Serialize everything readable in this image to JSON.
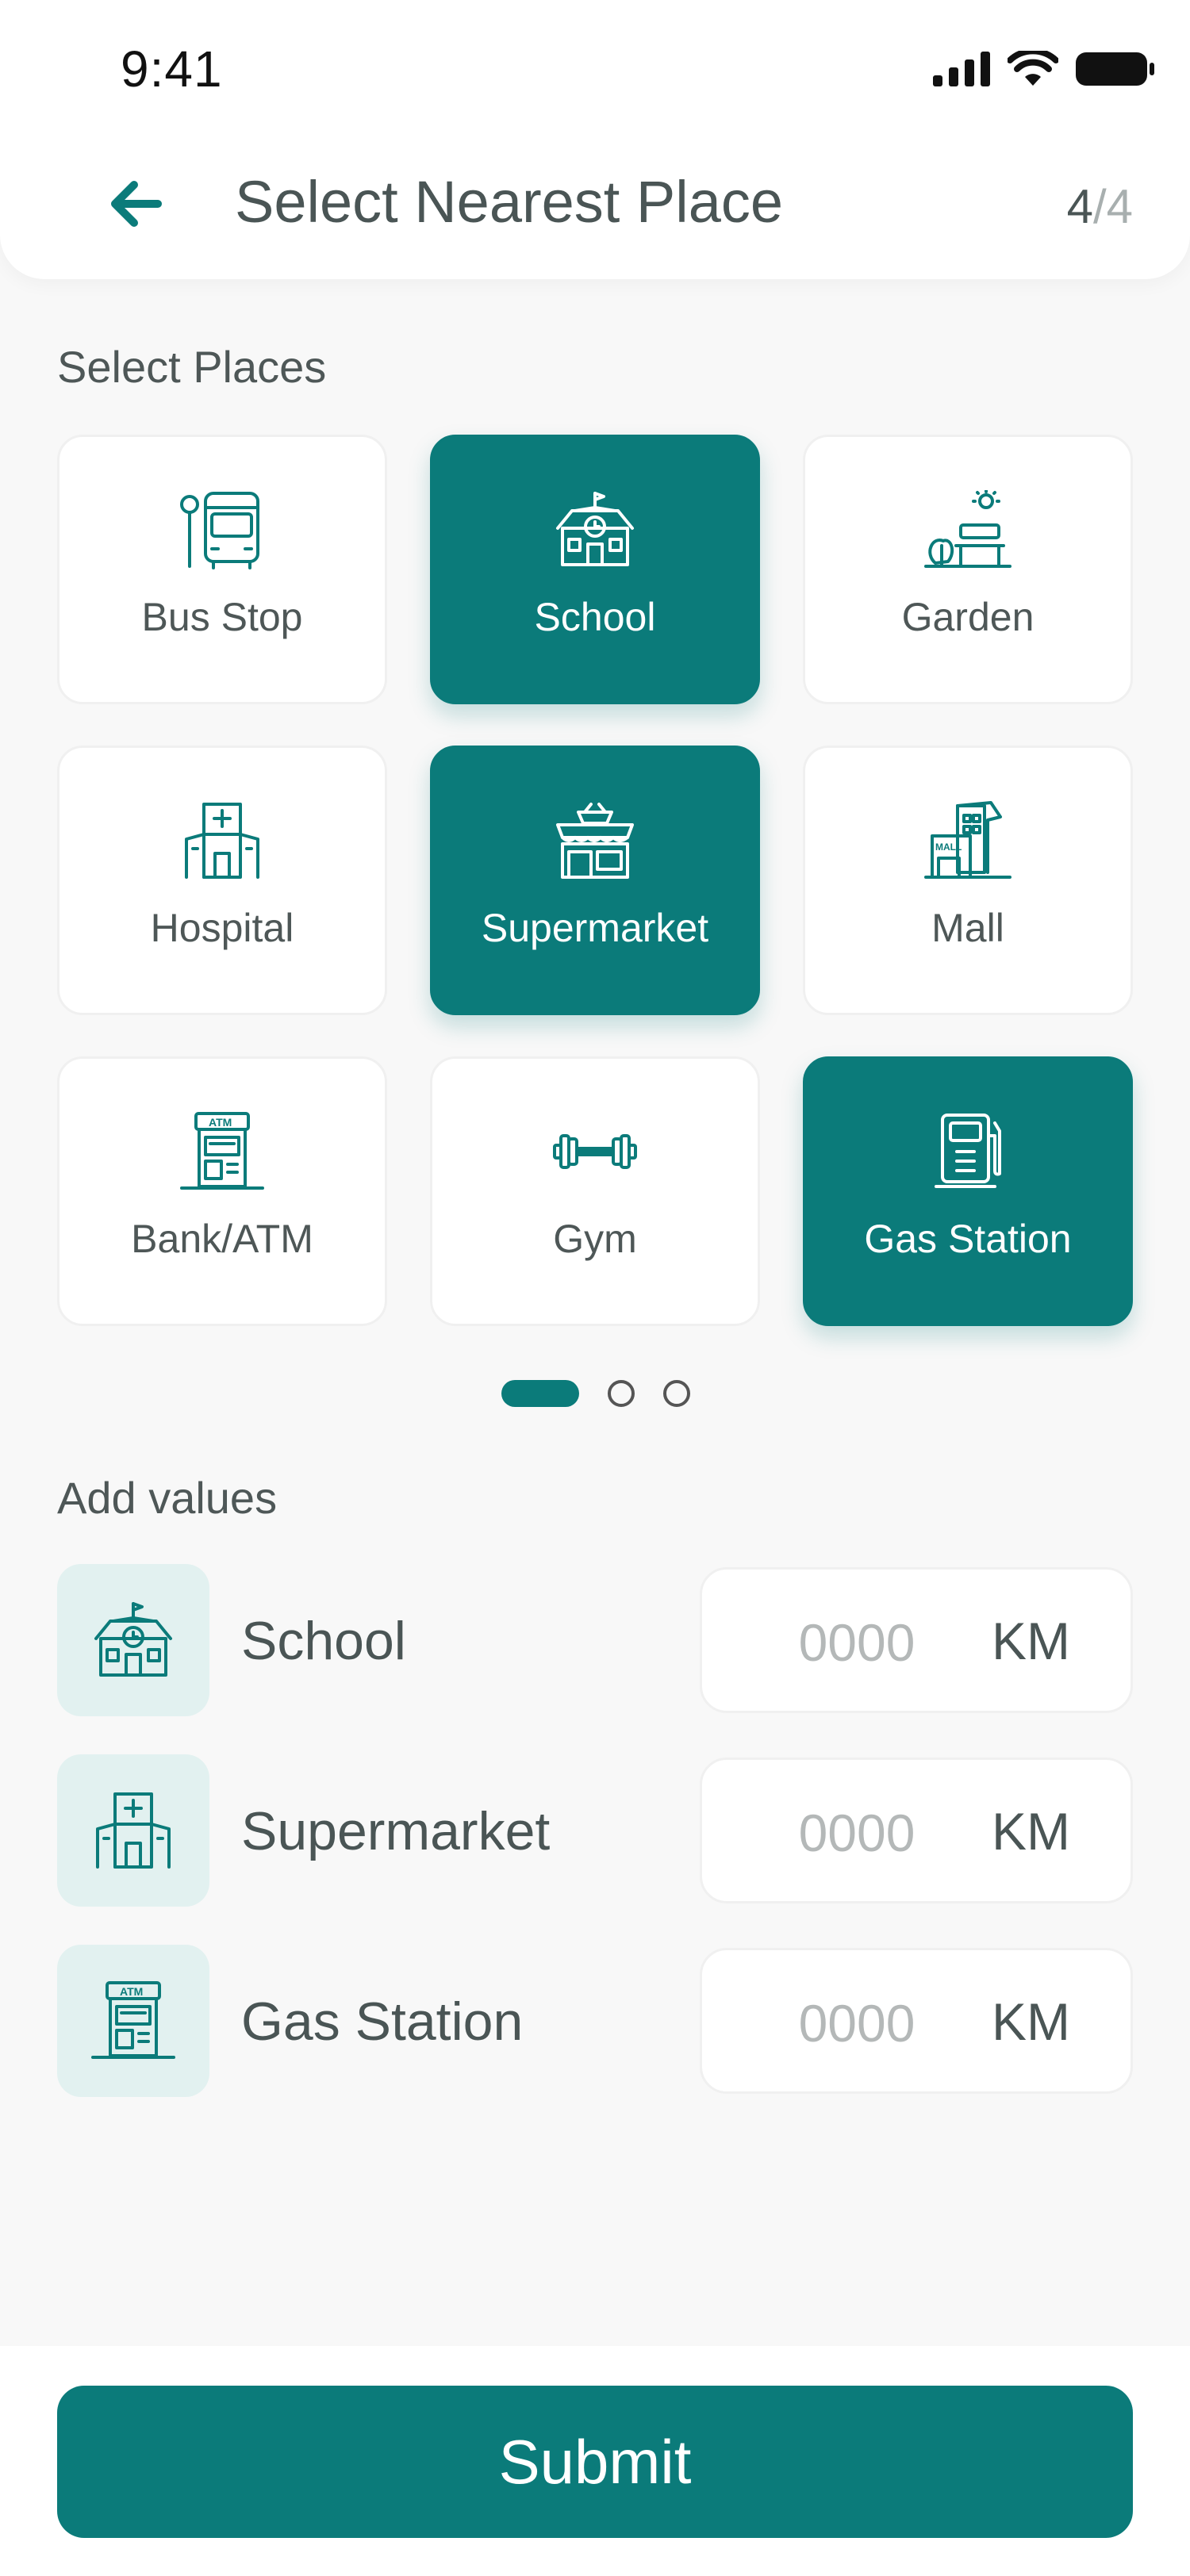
{
  "status_bar": {
    "time": "9:41"
  },
  "header": {
    "title": "Select Nearest Place",
    "step_current": "4",
    "step_separator": "/",
    "step_total": "4"
  },
  "places_section": {
    "label": "Select Places",
    "items": [
      {
        "label": "Bus Stop",
        "icon": "bus-stop-icon",
        "selected": false
      },
      {
        "label": "School",
        "icon": "school-icon",
        "selected": true
      },
      {
        "label": "Garden",
        "icon": "garden-icon",
        "selected": false
      },
      {
        "label": "Hospital",
        "icon": "hospital-icon",
        "selected": false
      },
      {
        "label": "Supermarket",
        "icon": "supermarket-icon",
        "selected": true
      },
      {
        "label": "Mall",
        "icon": "mall-icon",
        "selected": false
      },
      {
        "label": "Bank/ATM",
        "icon": "atm-icon",
        "selected": false
      },
      {
        "label": "Gym",
        "icon": "dumbbell-icon",
        "selected": false
      },
      {
        "label": "Gas Station",
        "icon": "gas-pump-icon",
        "selected": true
      }
    ],
    "pager": {
      "pages": 3,
      "active": 1
    }
  },
  "values_section": {
    "label": "Add values",
    "rows": [
      {
        "name": "School",
        "icon": "school-icon",
        "placeholder": "0000",
        "unit": "KM"
      },
      {
        "name": "Supermarket",
        "icon": "hospital-icon",
        "placeholder": "0000",
        "unit": "KM"
      },
      {
        "name": "Gas Station",
        "icon": "atm-icon",
        "placeholder": "0000",
        "unit": "KM"
      }
    ]
  },
  "submit": {
    "label": "Submit"
  },
  "colors": {
    "accent": "#0B7B7A",
    "accent_light": "#E2F1F0",
    "background": "#F8F8F8"
  }
}
